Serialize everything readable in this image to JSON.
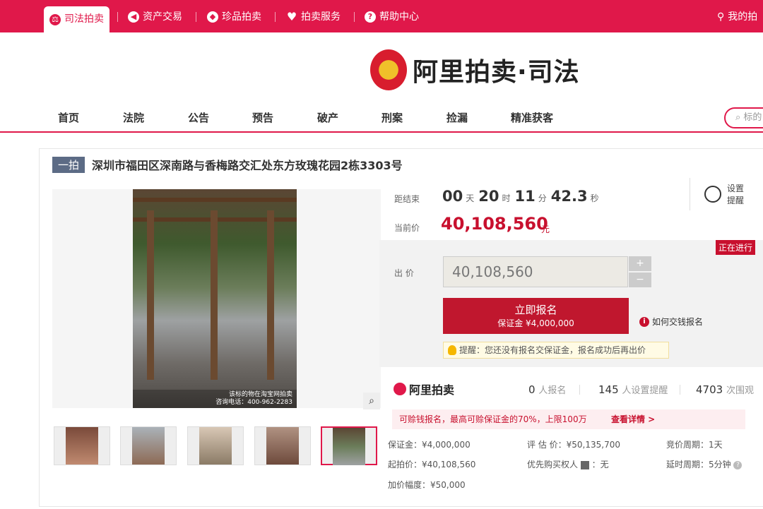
{
  "topbar": {
    "items": [
      {
        "label": "司法拍卖",
        "icon": "court-icon"
      },
      {
        "label": "资产交易",
        "icon": "asset-icon"
      },
      {
        "label": "珍品拍卖",
        "icon": "treasure-icon"
      },
      {
        "label": "拍卖服务",
        "icon": "heart-icon"
      },
      {
        "label": "帮助中心",
        "icon": "help-icon"
      }
    ],
    "user_label": "我的拍"
  },
  "logo": {
    "text": "阿里拍卖·司法"
  },
  "nav": {
    "items": [
      "首页",
      "法院",
      "公告",
      "预告",
      "破产",
      "刑案",
      "捡漏",
      "精准获客"
    ],
    "search_placeholder": "标的"
  },
  "lot": {
    "round_badge": "一拍",
    "title": "深圳市福田区深南路与香梅路交汇处东方玫瑰花园2栋3303号",
    "image_caption_1": "该标的物在淘宝网拍卖",
    "image_caption_2": "咨询电话：400-962-2283",
    "thumbnails": 5
  },
  "countdown": {
    "label": "距结束",
    "days": "00",
    "days_unit": "天",
    "hours": "20",
    "hours_unit": "时",
    "minutes": "11",
    "minutes_unit": "分",
    "seconds": "42.3",
    "seconds_unit": "秒"
  },
  "reminder": {
    "line1": "设置",
    "line2": "提醒"
  },
  "current_price": {
    "label": "当前价",
    "value": "40,108,560",
    "unit": "元"
  },
  "status_badge": "正在进行",
  "bid": {
    "label": "出 价",
    "value": "40,108,560",
    "plus": "+",
    "minus": "−",
    "signup_main": "立即报名",
    "signup_sub": "保证金 ¥4,000,000",
    "how_to": "如何交钱报名",
    "tip": "提醒：您还没有报名交保证金，报名成功后再出价"
  },
  "stats": {
    "brand": "阿里拍卖",
    "signups": "0",
    "signups_unit": "人报名",
    "reminders": "145",
    "reminders_unit": "人设置提醒",
    "views": "4703",
    "views_unit": "次围观"
  },
  "promo": {
    "text": "可赊钱报名，最高可赊保证金的70%，上限100万",
    "link": "查看详情 >"
  },
  "details": {
    "deposit": "保证金：¥4,000,000",
    "appraisal": "评 估 价：¥50,135,700",
    "cycle": "竞价周期：1天",
    "start_price": "起拍价：¥40,108,560",
    "priority": "优先购买权人",
    "priority_value": "：无",
    "delay": "延时周期：5分钟",
    "increment": "加价幅度：¥50,000"
  }
}
